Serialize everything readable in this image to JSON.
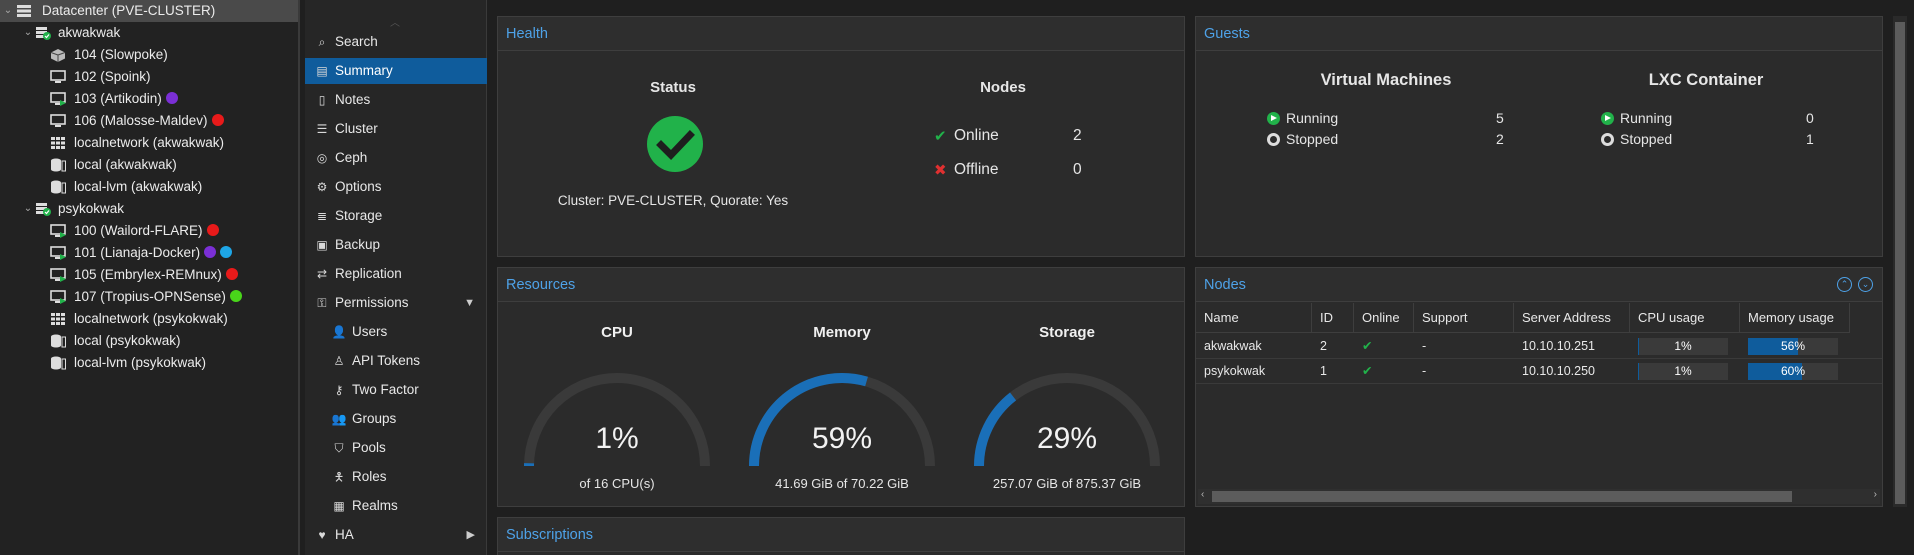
{
  "tree": {
    "datacenter": "Datacenter (PVE-CLUSTER)",
    "nodes": [
      {
        "name": "akwakwak",
        "items": [
          {
            "label": "104 (Slowpoke)",
            "type": "template",
            "tags": []
          },
          {
            "label": "102 (Spoink)",
            "type": "vm-stopped",
            "tags": []
          },
          {
            "label": "103 (Artikodin)",
            "type": "vm-running",
            "tags": [
              "#7b2fd6"
            ]
          },
          {
            "label": "106 (Malosse-Maldev)",
            "type": "vm-stopped",
            "tags": [
              "#e81a1a"
            ]
          },
          {
            "label": "localnetwork (akwakwak)",
            "type": "network",
            "tags": []
          },
          {
            "label": "local (akwakwak)",
            "type": "storage",
            "tags": []
          },
          {
            "label": "local-lvm (akwakwak)",
            "type": "storage",
            "tags": []
          }
        ]
      },
      {
        "name": "psykokwak",
        "items": [
          {
            "label": "100 (Wailord-FLARE)",
            "type": "vm-running",
            "tags": [
              "#e81a1a"
            ]
          },
          {
            "label": "101 (Lianaja-Docker)",
            "type": "vm-running",
            "tags": [
              "#7b2fd6",
              "#1ea6e6"
            ]
          },
          {
            "label": "105 (Embrylex-REMnux)",
            "type": "vm-running",
            "tags": [
              "#e81a1a"
            ]
          },
          {
            "label": "107 (Tropius-OPNSense)",
            "type": "vm-running",
            "tags": [
              "#49d61a"
            ]
          },
          {
            "label": "localnetwork (psykokwak)",
            "type": "network",
            "tags": []
          },
          {
            "label": "local (psykokwak)",
            "type": "storage",
            "tags": []
          },
          {
            "label": "local-lvm (psykokwak)",
            "type": "storage",
            "tags": []
          }
        ]
      }
    ]
  },
  "nav": [
    {
      "label": "Search",
      "icon": "search-icon",
      "glyph": "⌕",
      "indent": 0
    },
    {
      "label": "Summary",
      "icon": "book-icon",
      "glyph": "▤",
      "indent": 0,
      "active": true
    },
    {
      "label": "Notes",
      "icon": "notes-icon",
      "glyph": "▯",
      "indent": 0
    },
    {
      "label": "Cluster",
      "icon": "server-icon",
      "glyph": "☰",
      "indent": 0
    },
    {
      "label": "Ceph",
      "icon": "ceph-icon",
      "glyph": "◎",
      "indent": 0
    },
    {
      "label": "Options",
      "icon": "gear-icon",
      "glyph": "⚙",
      "indent": 0
    },
    {
      "label": "Storage",
      "icon": "database-icon",
      "glyph": "≣",
      "indent": 0
    },
    {
      "label": "Backup",
      "icon": "floppy-icon",
      "glyph": "▣",
      "indent": 0
    },
    {
      "label": "Replication",
      "icon": "retweet-icon",
      "glyph": "⇄",
      "indent": 0
    },
    {
      "label": "Permissions",
      "icon": "unlock-icon",
      "glyph": "⚿",
      "indent": 0,
      "caret": "▼"
    },
    {
      "label": "Users",
      "icon": "user-icon",
      "glyph": "👤",
      "indent": 1
    },
    {
      "label": "API Tokens",
      "icon": "user-tag-icon",
      "glyph": "♙",
      "indent": 1
    },
    {
      "label": "Two Factor",
      "icon": "key-icon",
      "glyph": "⚷",
      "indent": 1
    },
    {
      "label": "Groups",
      "icon": "users-icon",
      "glyph": "👥",
      "indent": 1
    },
    {
      "label": "Pools",
      "icon": "tags-icon",
      "glyph": "⛉",
      "indent": 1
    },
    {
      "label": "Roles",
      "icon": "male-icon",
      "glyph": "🯅",
      "indent": 1
    },
    {
      "label": "Realms",
      "icon": "address-book-icon",
      "glyph": "▦",
      "indent": 1
    },
    {
      "label": "HA",
      "icon": "heartbeat-icon",
      "glyph": "♥",
      "indent": 0,
      "caret": "▶"
    }
  ],
  "health": {
    "title": "Health",
    "status_title": "Status",
    "cluster_text": "Cluster: PVE-CLUSTER, Quorate: Yes",
    "nodes_title": "Nodes",
    "online_label": "Online",
    "online_value": "2",
    "offline_label": "Offline",
    "offline_value": "0",
    "ok_color": "#21b24a"
  },
  "guests": {
    "title": "Guests",
    "vm_title": "Virtual Machines",
    "vm_running_label": "Running",
    "vm_running": "5",
    "vm_stopped_label": "Stopped",
    "vm_stopped": "2",
    "lxc_title": "LXC Container",
    "lxc_running_label": "Running",
    "lxc_running": "0",
    "lxc_stopped_label": "Stopped",
    "lxc_stopped": "1"
  },
  "resources": {
    "title": "Resources",
    "gauges": [
      {
        "label": "CPU",
        "value_text": "1%",
        "fraction": 0.01,
        "sub": "of 16 CPU(s)"
      },
      {
        "label": "Memory",
        "value_text": "59%",
        "fraction": 0.59,
        "sub": "41.69 GiB of 70.22 GiB"
      },
      {
        "label": "Storage",
        "value_text": "29%",
        "fraction": 0.29,
        "sub": "257.07 GiB of 875.37 GiB"
      }
    ],
    "accent": "#1a6fb8",
    "track": "#3a3a3a"
  },
  "nodes_panel": {
    "title": "Nodes",
    "columns": [
      "Name",
      "ID",
      "Online",
      "Support",
      "Server Address",
      "CPU usage",
      "Memory usage"
    ],
    "rows": [
      {
        "name": "akwakwak",
        "id": "2",
        "online": "✔",
        "support": "-",
        "address": "10.10.10.251",
        "cpu_text": "1%",
        "cpu": 0.01,
        "mem_text": "56%",
        "mem": 0.56
      },
      {
        "name": "psykokwak",
        "id": "1",
        "online": "✔",
        "support": "-",
        "address": "10.10.10.250",
        "cpu_text": "1%",
        "cpu": 0.01,
        "mem_text": "60%",
        "mem": 0.6
      }
    ]
  },
  "subscriptions": {
    "title": "Subscriptions"
  }
}
